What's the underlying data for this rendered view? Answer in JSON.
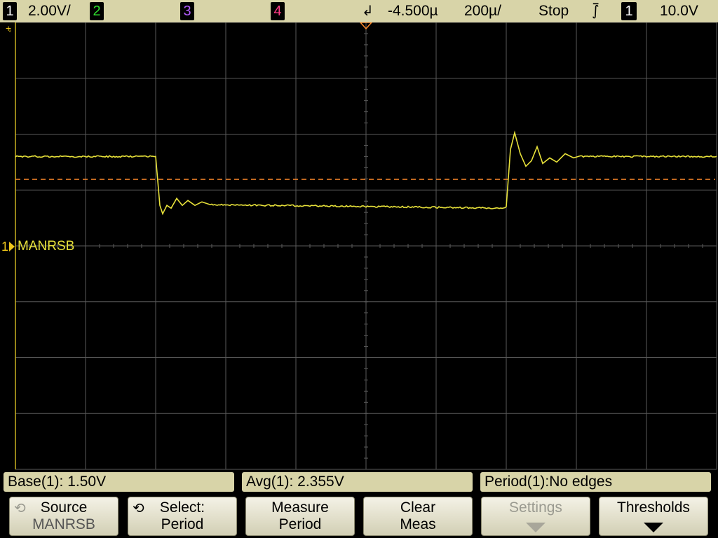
{
  "topbar": {
    "ch1_num": "1",
    "ch1_scale": "2.00V/",
    "ch2_num": "2",
    "ch3_num": "3",
    "ch4_num": "4",
    "trigger_delay": "-4.500µ",
    "timebase": "200µ/",
    "run_state": "Stop",
    "trigger_slope_icon": "falling-edge-icon",
    "trigger_source": "1",
    "trigger_level": "10.0V"
  },
  "scope": {
    "channel_marker": "1",
    "channel_label": "MANRSB",
    "colors": {
      "trace": "#e8e23a",
      "grid": "#5a5a5a",
      "trigger_line": "#ff8a2a",
      "marker": "#f0c81a"
    },
    "trace": {
      "high_level_div": 1.6,
      "low_level_div": 0.75,
      "falling_edge_div": 2.0,
      "rising_edge_div": 7.0
    }
  },
  "measurements": {
    "m1": "Base(1): 1.50V",
    "m2": "Avg(1): 2.355V",
    "m3": "Period(1):No edges"
  },
  "softkeys": {
    "source_l1": "Source",
    "source_l2": "MANRSB",
    "select_l1": "Select:",
    "select_l2": "Period",
    "measure_l1": "Measure",
    "measure_l2": "Period",
    "clear_l1": "Clear",
    "clear_l2": "Meas",
    "settings_l1": "Settings",
    "thresholds_l1": "Thresholds"
  }
}
